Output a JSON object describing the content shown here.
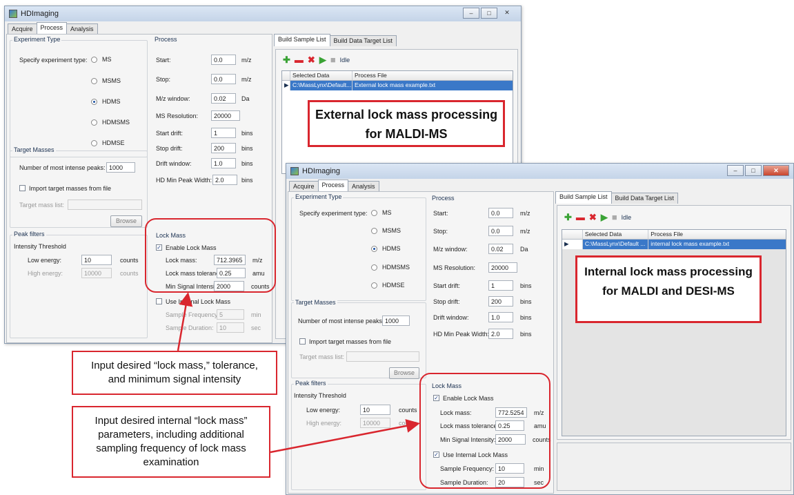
{
  "app_title": "HDImaging",
  "tabs": [
    "Acquire",
    "Process",
    "Analysis"
  ],
  "right_tabs": [
    "Build Sample List",
    "Build Data Target List"
  ],
  "experiment": {
    "title": "Experiment Type",
    "specify_label": "Specify experiment type:",
    "options": [
      "MS",
      "MSMS",
      "HDMS",
      "HDMSMS",
      "HDMSE"
    ],
    "selected": "HDMS"
  },
  "process": {
    "title": "Process",
    "start_label": "Start:",
    "start_value": "0.0",
    "start_unit": "m/z",
    "stop_label": "Stop:",
    "stop_value": "0.0",
    "stop_unit": "m/z",
    "mzwin_label": "M/z window:",
    "mzwin_value": "0.02",
    "mzwin_unit": "Da",
    "res_label": "MS Resolution:",
    "res_value": "20000",
    "startdrift_label": "Start drift:",
    "startdrift_value": "1",
    "startdrift_unit": "bins",
    "stopdrift_label": "Stop drift:",
    "stopdrift_value": "200",
    "stopdrift_unit": "bins",
    "driftwin_label": "Drift window:",
    "driftwin_value": "1.0",
    "driftwin_unit": "bins",
    "peakwidth_label": "HD Min Peak Width:",
    "peakwidth_value": "2.0",
    "peakwidth_unit": "bins"
  },
  "target": {
    "title": "Target Masses",
    "num_label": "Number of most intense peaks:",
    "num_value": "1000",
    "import_label": "Import target masses from file",
    "list_label": "Target mass list:",
    "browse_label": "Browse"
  },
  "peak": {
    "title": "Peak filters",
    "threshold_label": "Intensity Threshold",
    "low_label": "Low energy:",
    "low_value": "10",
    "low_unit": "counts",
    "high_label": "High energy:",
    "high_value": "10000",
    "high_unit": "counts"
  },
  "lock_labels": {
    "title": "Lock Mass",
    "enable_label": "Enable Lock Mass",
    "mass_label": "Lock mass:",
    "mass_unit": "m/z",
    "tol_label": "Lock mass tolerance:",
    "tol_unit": "amu",
    "minsig_label": "Min Signal Intensity:",
    "minsig_unit": "counts",
    "internal_label": "Use Internal Lock Mass",
    "freq_label": "Sample Frequency:",
    "freq_unit": "min",
    "dur_label": "Sample Duration:",
    "dur_unit": "sec"
  },
  "lock1": {
    "mass": "712.3965",
    "tol": "0.25",
    "minsig": "2000",
    "freq": "5",
    "dur": "10"
  },
  "lock2": {
    "mass": "772.5254",
    "tol": "0.25",
    "minsig": "2000",
    "freq": "10",
    "dur": "20"
  },
  "sample_list": {
    "idle_label": "Idle",
    "col_selected": "Selected Data",
    "col_process": "Process File",
    "row1_selected": "C:\\MassLynx\\Default...",
    "row1_process": "External lock mass example.txt",
    "row2_selected": "C:\\MassLynx\\Default ...",
    "row2_process": "internal lock mass example.txt"
  },
  "callouts": {
    "external": "External lock mass processing for MALDI-MS",
    "internal": "Internal lock mass processing for MALDI and DESI-MS",
    "note1": "Input desired “lock mass,” tolerance, and minimum signal intensity",
    "note2": "Input desired internal “lock mass” parameters, including additional sampling frequency of lock mass examination"
  },
  "colors": {
    "accent_red": "#d9262e",
    "selection_blue": "#3a78c8",
    "add_green": "#3aa335"
  }
}
